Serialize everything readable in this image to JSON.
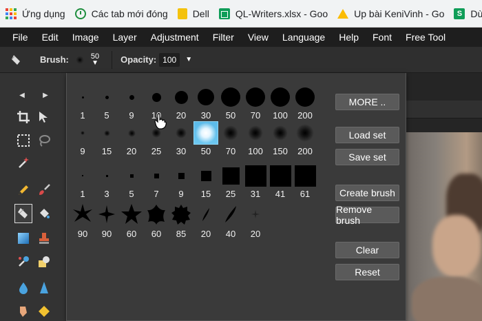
{
  "bookmarks": [
    {
      "label": "Ứng dụng",
      "icon": "apps-icon"
    },
    {
      "label": "Các tab mới đóng",
      "icon": "history-icon"
    },
    {
      "label": "Dell",
      "icon": "folder-icon"
    },
    {
      "label": "QL-Writers.xlsx - Goo",
      "icon": "sheets-icon"
    },
    {
      "label": "Up bài KeniVinh - Go",
      "icon": "drive-icon"
    },
    {
      "label": "Dùng Gmail",
      "icon": "s-icon"
    }
  ],
  "menu": [
    "File",
    "Edit",
    "Image",
    "Layer",
    "Adjustment",
    "Filter",
    "View",
    "Language",
    "Help",
    "Font",
    "Free Tool"
  ],
  "options": {
    "brush_label": "Brush:",
    "brush_size": "50",
    "opacity_label": "Opacity:",
    "opacity_value": "100"
  },
  "brushes": {
    "rows": [
      {
        "style": "hard",
        "sizes": [
          "1",
          "5",
          "9",
          "10",
          "20",
          "30",
          "50",
          "70",
          "100",
          "200"
        ]
      },
      {
        "style": "soft",
        "sizes": [
          "9",
          "15",
          "20",
          "25",
          "30",
          "50",
          "70",
          "100",
          "150",
          "200"
        ]
      },
      {
        "style": "square",
        "sizes": [
          "1",
          "3",
          "5",
          "7",
          "9",
          "15",
          "25",
          "31",
          "41",
          "61"
        ]
      },
      {
        "style": "custom",
        "sizes": [
          "90",
          "90",
          "60",
          "60",
          "85",
          "20",
          "40",
          "20"
        ]
      }
    ],
    "selected": {
      "row": 1,
      "index": 5
    }
  },
  "panel_buttons": {
    "more": "MORE ..",
    "load_set": "Load set",
    "save_set": "Save set",
    "create_brush": "Create brush",
    "remove_brush": "Remove brush",
    "clear": "Clear",
    "reset": "Reset"
  },
  "colors": {
    "selected_cell": "#5ab9e8",
    "menubar": "#1e1e1e",
    "panel": "#3a3a3a"
  }
}
